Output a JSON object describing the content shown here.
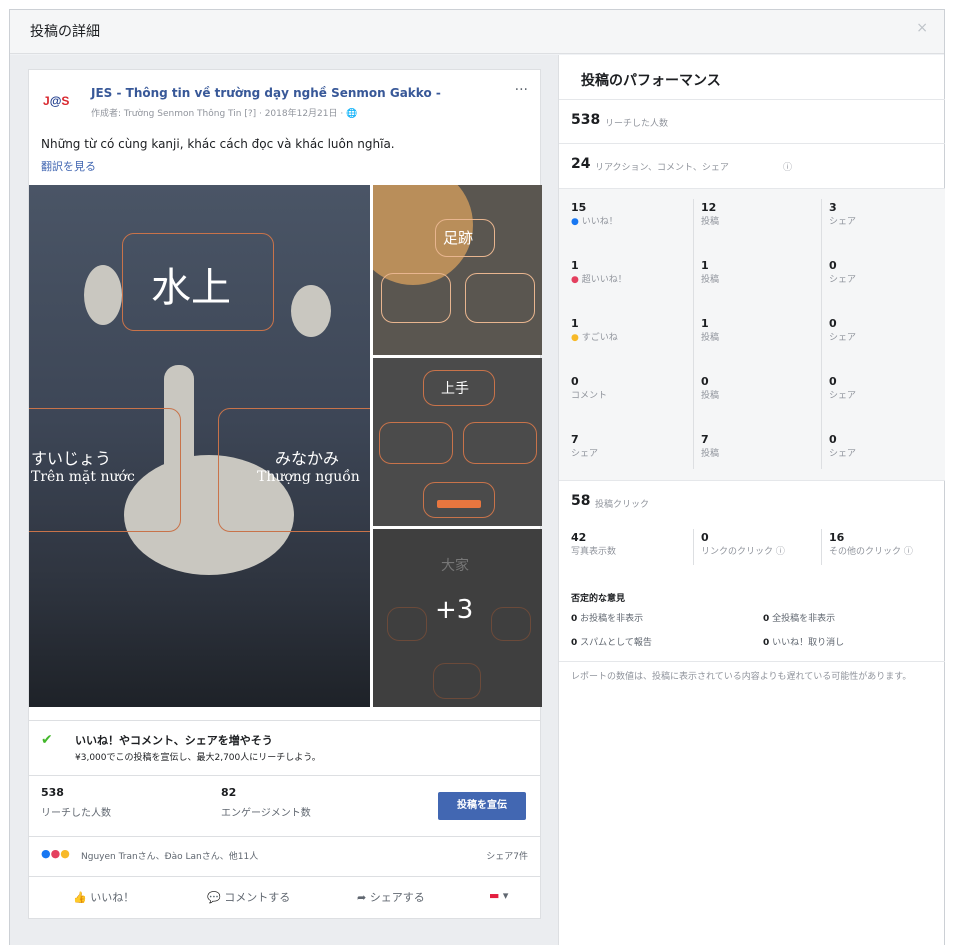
{
  "dialog": {
    "title": "投稿の詳細",
    "close_label": "×"
  },
  "post": {
    "page_logo": "J@S",
    "page_name": "JES - Thông tin về trường dạy nghề Senmon Gakko -",
    "meta": "作成者: Trường Senmon Thông Tin [?] · 2018年12月21日 · 🌐",
    "more_label": "···",
    "body_text": "Những từ có cùng kanji, khác cách đọc và khác luôn nghĩa.",
    "translate_link": "翻訳を見る",
    "photo_main": {
      "kanji": "水上",
      "left_kana": "すいじょう",
      "left_viet": "Trên mặt nước",
      "right_kana": "みなかみ",
      "right_viet": "Thượng nguồn"
    },
    "photo_side1": {
      "kanji": "足跡"
    },
    "photo_side2": {
      "kanji": "上手"
    },
    "photo_side3": {
      "kanji": "大家",
      "more_count": "+3"
    },
    "promo": {
      "title": "いいね！やコメント、シェアを増やそう",
      "subtitle": "¥3,000でこの投稿を宣伝し、最大2,700人にリーチしよう。"
    },
    "stats": {
      "reach_value": "538",
      "reach_label": "リーチした人数",
      "engagement_value": "82",
      "engagement_label": "エンゲージメント数",
      "boost_button": "投稿を宣伝"
    },
    "reactions": {
      "names": "Nguyen Tranさん、Đào Lanさん、他11人",
      "shares": "シェア7件"
    },
    "actions": {
      "like": "いいね！",
      "comment": "コメントする",
      "share": "シェアする"
    }
  },
  "performance": {
    "title": "投稿のパフォーマンス",
    "reach_value": "538",
    "reach_label": "リーチした人数",
    "interactions_value": "24",
    "interactions_label": "リアクション、コメント、シェア",
    "rows": [
      {
        "a_num": "15",
        "a_label": "いいね！",
        "b_num": "12",
        "b_label": "投稿",
        "c_num": "3",
        "c_label": "シェア"
      },
      {
        "a_num": "1",
        "a_label": "超いいね！",
        "b_num": "1",
        "b_label": "投稿",
        "c_num": "0",
        "c_label": "シェア"
      },
      {
        "a_num": "1",
        "a_label": "すごいね",
        "b_num": "1",
        "b_label": "投稿",
        "c_num": "0",
        "c_label": "シェア"
      },
      {
        "a_num": "0",
        "a_label": "コメント",
        "b_num": "0",
        "b_label": "投稿",
        "c_num": "0",
        "c_label": "シェア"
      },
      {
        "a_num": "7",
        "a_label": "シェア",
        "b_num": "7",
        "b_label": "投稿",
        "c_num": "0",
        "c_label": "シェア"
      }
    ],
    "clicks_value": "58",
    "clicks_label": "投稿クリック",
    "clicks": [
      {
        "num": "42",
        "label": "写真表示数"
      },
      {
        "num": "0",
        "label": "リンクのクリック"
      },
      {
        "num": "16",
        "label": "その他のクリック"
      }
    ],
    "negative_title": "否定的な意見",
    "negative": [
      {
        "num": "0",
        "label": "お投稿を非表示"
      },
      {
        "num": "0",
        "label": "全投稿を非表示"
      },
      {
        "num": "0",
        "label": "スパムとして報告"
      },
      {
        "num": "0",
        "label": "いいね！取り消し"
      }
    ],
    "note": "レポートの数値は、投稿に表示されている内容よりも遅れている可能性があります。"
  }
}
